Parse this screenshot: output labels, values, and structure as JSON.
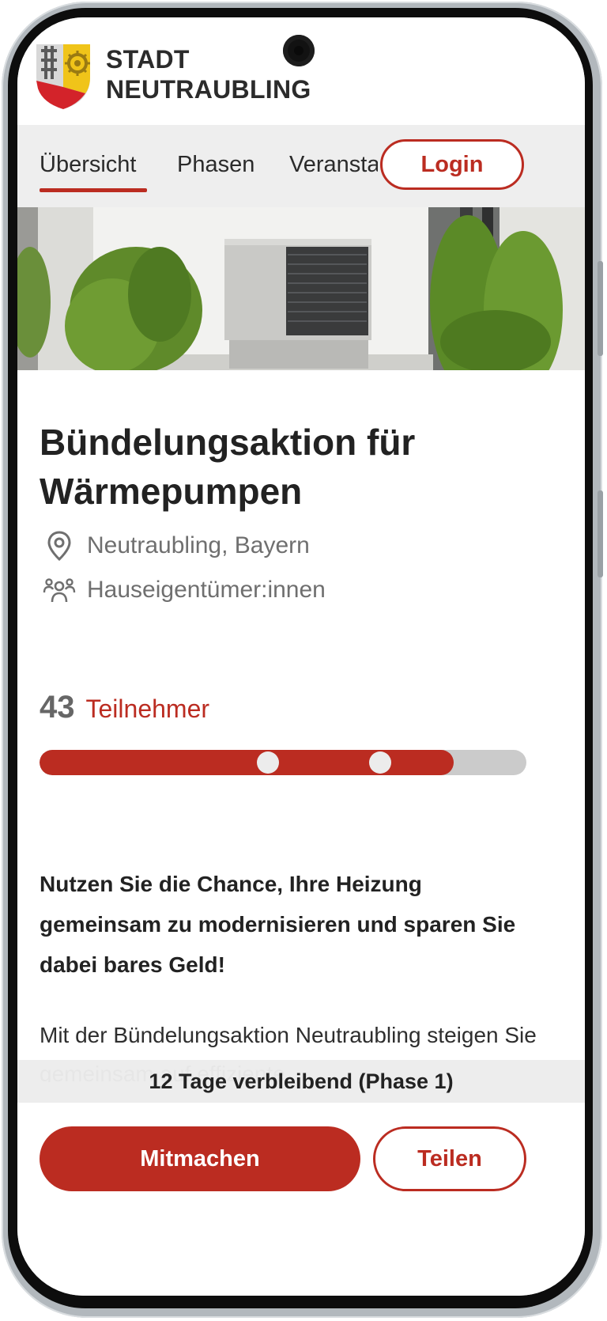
{
  "header": {
    "brand_line1": "STADT",
    "brand_line2": "NEUTRAUBLING"
  },
  "nav": {
    "tabs": [
      {
        "label": "Übersicht",
        "active": true
      },
      {
        "label": "Phasen",
        "active": false
      },
      {
        "label": "Veranstaltungen",
        "active": false
      }
    ],
    "login_label": "Login"
  },
  "project": {
    "title": "Bündelungsaktion für Wärmepumpen",
    "location": "Neutraubling, Bayern",
    "audience": "Hauseigentümer:innen",
    "participants_count": "43",
    "participants_label": "Teilnehmer",
    "progress_fraction": 0.85,
    "milestone_fractions": [
      0.469,
      0.7
    ],
    "lead": "Nutzen Sie die Chance, Ihre Heizung gemeinsam zu modernisieren und sparen Sie dabei bares Geld!",
    "body": "Mit der Bündelungsaktion Neutraubling steigen Sie gemeinsam auf effiziente"
  },
  "footer": {
    "remaining": "12 Tage verbleibend (Phase 1)",
    "primary_label": "Mitmachen",
    "secondary_label": "Teilen"
  },
  "colors": {
    "accent": "#bb2c21",
    "track": "#cbcbcb"
  },
  "icons": {
    "location": "map-pin-icon",
    "audience": "people-group-icon",
    "crest": "city-crest-icon"
  }
}
